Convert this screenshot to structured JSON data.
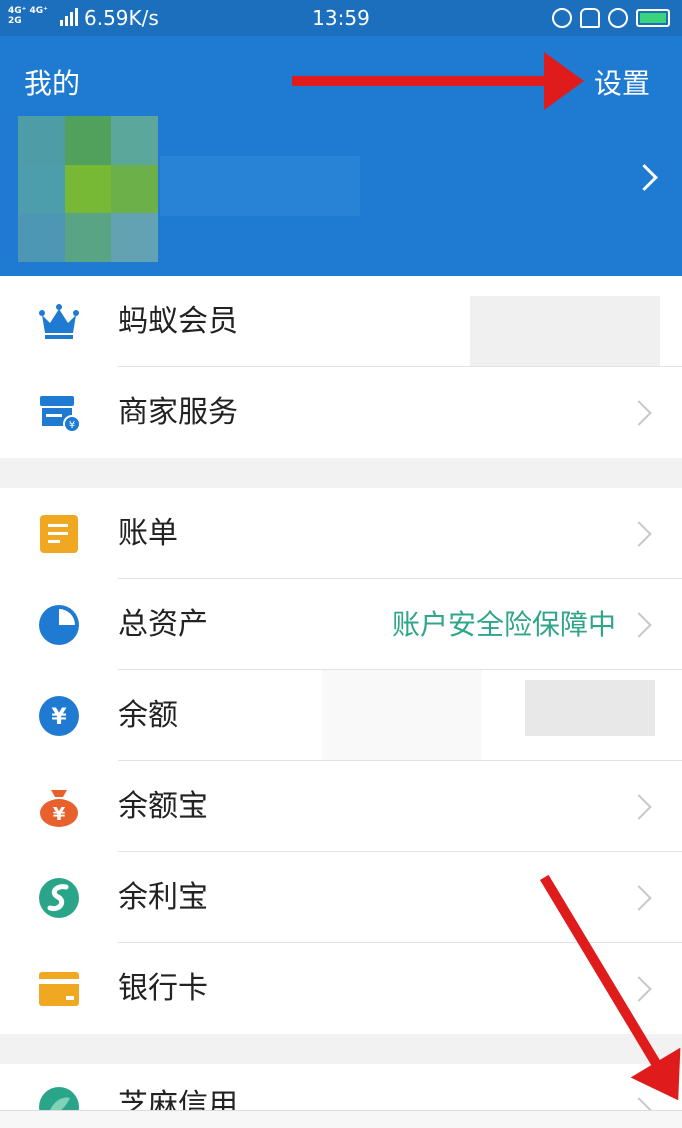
{
  "status_bar": {
    "network": "4G⁺ 4G⁺\n2G",
    "speed": "6.59K/s",
    "time": "13:59",
    "icons": [
      "headset-icon",
      "bell-off-icon",
      "alarm-icon",
      "battery-charging-icon"
    ]
  },
  "header": {
    "title": "我的",
    "settings_label": "设置"
  },
  "group1": [
    {
      "label": "蚂蚁会员",
      "icon": "crown-icon",
      "color": "#1f7ad2"
    },
    {
      "label": "商家服务",
      "icon": "store-icon",
      "color": "#1f7ad2"
    }
  ],
  "group2": [
    {
      "label": "账单",
      "icon": "bill-icon",
      "color": "#f0a823"
    },
    {
      "label": "总资产",
      "icon": "pie-chart-icon",
      "color": "#1f7ad2",
      "status": "账户安全险保障中"
    },
    {
      "label": "余额",
      "icon": "yuan-coin-icon",
      "color": "#1f7ad2"
    },
    {
      "label": "余额宝",
      "icon": "money-bag-icon",
      "color": "#e8612c"
    },
    {
      "label": "余利宝",
      "icon": "yulibao-icon",
      "color": "#2aa58a"
    },
    {
      "label": "银行卡",
      "icon": "bank-card-icon",
      "color": "#f0a823"
    }
  ],
  "group3": [
    {
      "label": "芝麻信用",
      "icon": "sesame-icon",
      "color": "#2aa58a"
    }
  ],
  "colors": {
    "header_bg": "#1f7ad2",
    "status_green": "#2fa58a",
    "annotation_red": "#e01b1b"
  }
}
